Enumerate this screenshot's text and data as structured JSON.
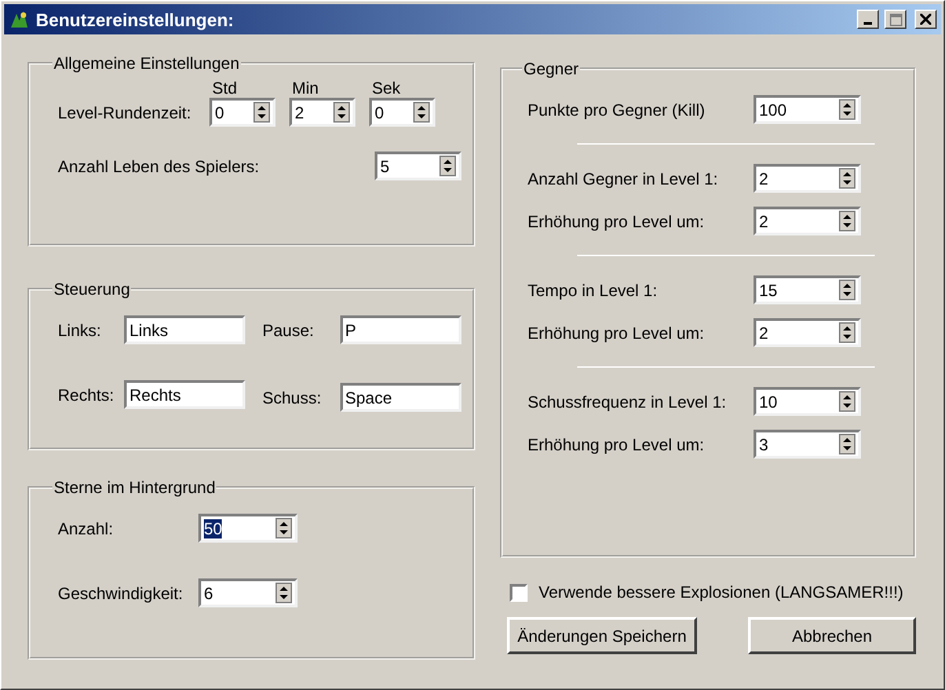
{
  "window": {
    "title": "Benutzereinstellungen:"
  },
  "general": {
    "title": "Allgemeine Einstellungen",
    "round_time": {
      "label": "Level-Rundenzeit:",
      "fields": [
        {
          "header": "Std",
          "value": "0"
        },
        {
          "header": "Min",
          "value": "2"
        },
        {
          "header": "Sek",
          "value": "0"
        }
      ]
    },
    "lives": {
      "label": "Anzahl Leben des Spielers:",
      "value": "5"
    }
  },
  "controls": {
    "title": "Steuerung",
    "fields": [
      {
        "label": "Links:",
        "value": "Links"
      },
      {
        "label": "Pause:",
        "value": "P"
      },
      {
        "label": "Rechts:",
        "value": "Rechts"
      },
      {
        "label": "Schuss:",
        "value": "Space"
      }
    ]
  },
  "stars": {
    "title": "Sterne im Hintergrund",
    "fields": [
      {
        "label": "Anzahl:",
        "value": "50",
        "selected": true
      },
      {
        "label": "Geschwindigkeit:",
        "value": "6",
        "selected": false
      }
    ]
  },
  "enemies": {
    "title": "Gegner",
    "groups": [
      {
        "fields": [
          {
            "label": "Punkte pro Gegner (Kill)",
            "value": "100"
          }
        ]
      },
      {
        "fields": [
          {
            "label": "Anzahl Gegner in Level 1:",
            "value": "2"
          },
          {
            "label": "Erhöhung pro Level um:",
            "value": "2"
          }
        ]
      },
      {
        "fields": [
          {
            "label": "Tempo in Level 1:",
            "value": "15"
          },
          {
            "label": "Erhöhung pro Level um:",
            "value": "2"
          }
        ]
      },
      {
        "fields": [
          {
            "label": "Schussfrequenz in Level 1:",
            "value": "10"
          },
          {
            "label": "Erhöhung pro Level um:",
            "value": "3"
          }
        ]
      }
    ]
  },
  "checkbox": {
    "label": "Verwende bessere Explosionen (LANGSAMER!!!)",
    "checked": false
  },
  "buttons": [
    "Änderungen Speichern",
    "Abbrechen"
  ]
}
